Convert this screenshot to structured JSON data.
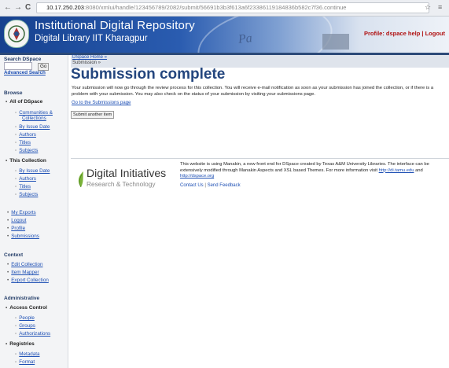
{
  "browser": {
    "url_host": "10.17.250.203",
    "url_rest": ":8080/xmlui/handle/123456789/2082/submit/56691b3b3f613a6f23386119184836b582c7f36.continue",
    "back": "←",
    "forward": "→",
    "reload": "C",
    "star": "☆",
    "menu": "≡"
  },
  "header": {
    "title_line1": "Institutional Digital Repository",
    "title_line2": "Digital Library IIT Kharagpur",
    "profile_link": "Profile: dspace",
    "help_link": "help",
    "logout_link": "Logout",
    "separator": "|"
  },
  "sidebar": {
    "search_heading": "Search DSpace",
    "go_label": "Go",
    "advanced_search": "Advanced Search",
    "browse_heading": "Browse",
    "all_of_dspace": "All of DSpace",
    "all_items": [
      "Communities &",
      "Collections",
      "By Issue Date",
      "Authors",
      "Titles",
      "Subjects"
    ],
    "this_collection": "This Collection",
    "collection_items": [
      "By Issue Date",
      "Authors",
      "Titles",
      "Subjects"
    ],
    "account_items": [
      "My Exports",
      "Logout",
      "Profile",
      "Submissions"
    ],
    "context_heading": "Context",
    "context_items": [
      "Edit Collection",
      "Item Mapper",
      "Export Collection"
    ],
    "admin_heading": "Administrative",
    "access_control": "Access Control",
    "access_items": [
      "People",
      "Groups",
      "Authorizations"
    ],
    "registries": "Registries",
    "registry_items": [
      "Metadata",
      "Format"
    ]
  },
  "main": {
    "breadcrumb_home": "DSpace Home »",
    "breadcrumb_current": "Submission »",
    "page_title": "Submission complete",
    "message": "Your submission will now go through the review process for this collection. You will receive e-mail notification as soon as your submission has joined the collection, or if there is a problem with your submission. You may also check on the status of your submission by visiting your submissions page.",
    "goto_link": "Go to the Submissions page",
    "another_button": "Submit another item"
  },
  "footer": {
    "logo_line1": "Digital Initiatives",
    "logo_line2": "Research & Technology",
    "text": "This website is using Manakin, a new front end for DSpace created by Texas A&M University Libraries. The interface can be extensively modified through Manakin Aspects and XSL based Themes. For more information visit",
    "link1": "http://di.tamu.edu",
    "and": "and",
    "link2": "http://dspace.org",
    "contact": "Contact Us",
    "feedback": "Send Feedback",
    "separator": "|"
  },
  "colors": {
    "banner_dark": "#16418f",
    "title_blue": "#24467e",
    "link_blue": "#1d4fb4",
    "profile_red": "#b01010"
  }
}
